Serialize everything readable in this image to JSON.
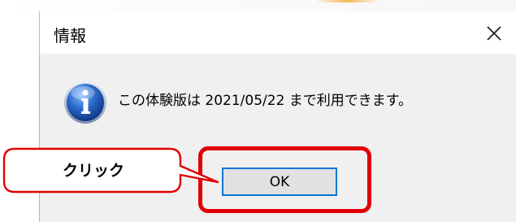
{
  "dialog": {
    "title": "情報",
    "close_icon": "close-icon",
    "message": "この体験版は 2021/05/22 まで利用できます。",
    "info_icon": "info-icon",
    "ok_label": "OK"
  },
  "annotation": {
    "callout_text": "クリック",
    "highlight_color": "#e00000"
  },
  "colors": {
    "button_focus_border": "#0078d7",
    "dialog_background": "#f0f0f0",
    "titlebar_background": "#ffffff"
  }
}
